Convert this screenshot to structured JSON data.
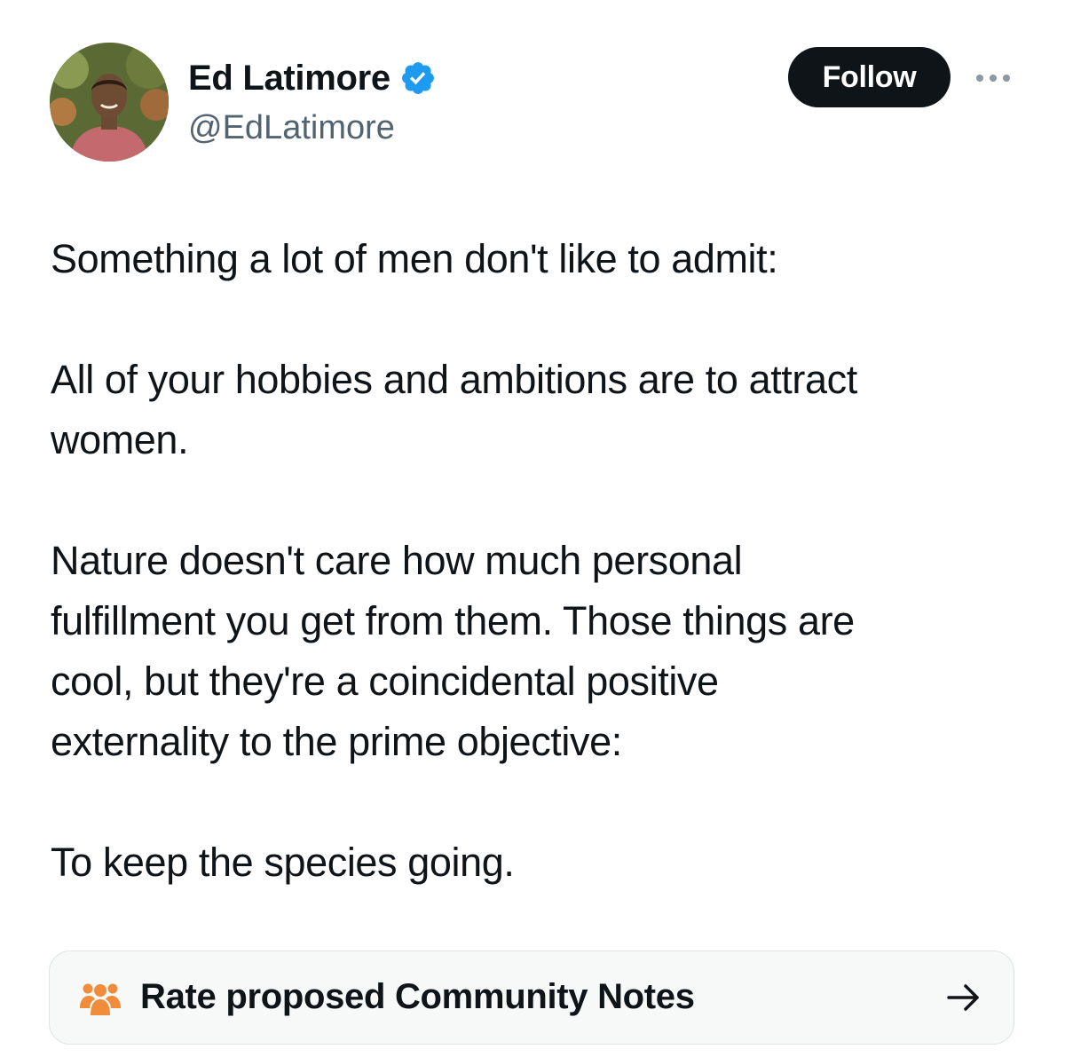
{
  "author": {
    "display_name": "Ed Latimore",
    "handle": "@EdLatimore",
    "verified": true,
    "avatar_icon": "profile-photo"
  },
  "actions": {
    "follow_label": "Follow",
    "more_icon": "more-horizontal-icon"
  },
  "tweet": {
    "paragraphs": [
      "Something a lot of men don't like to admit:",
      "All of your hobbies and ambitions are to attract\nwomen.",
      "Nature doesn't care how much personal\nfulfillment you get from them. Those things are\ncool, but they're a coincidental positive\nexternality to the prime objective:",
      "To keep the species going."
    ]
  },
  "community_notes": {
    "label": "Rate proposed Community Notes",
    "icon": "people-group-icon",
    "arrow_icon": "arrow-right-icon"
  },
  "colors": {
    "text": "#0f1419",
    "secondary_text": "#536471",
    "verified_blue": "#1d9bf0",
    "notes_orange": "#f08c3a",
    "follow_bg": "#0f1419"
  }
}
